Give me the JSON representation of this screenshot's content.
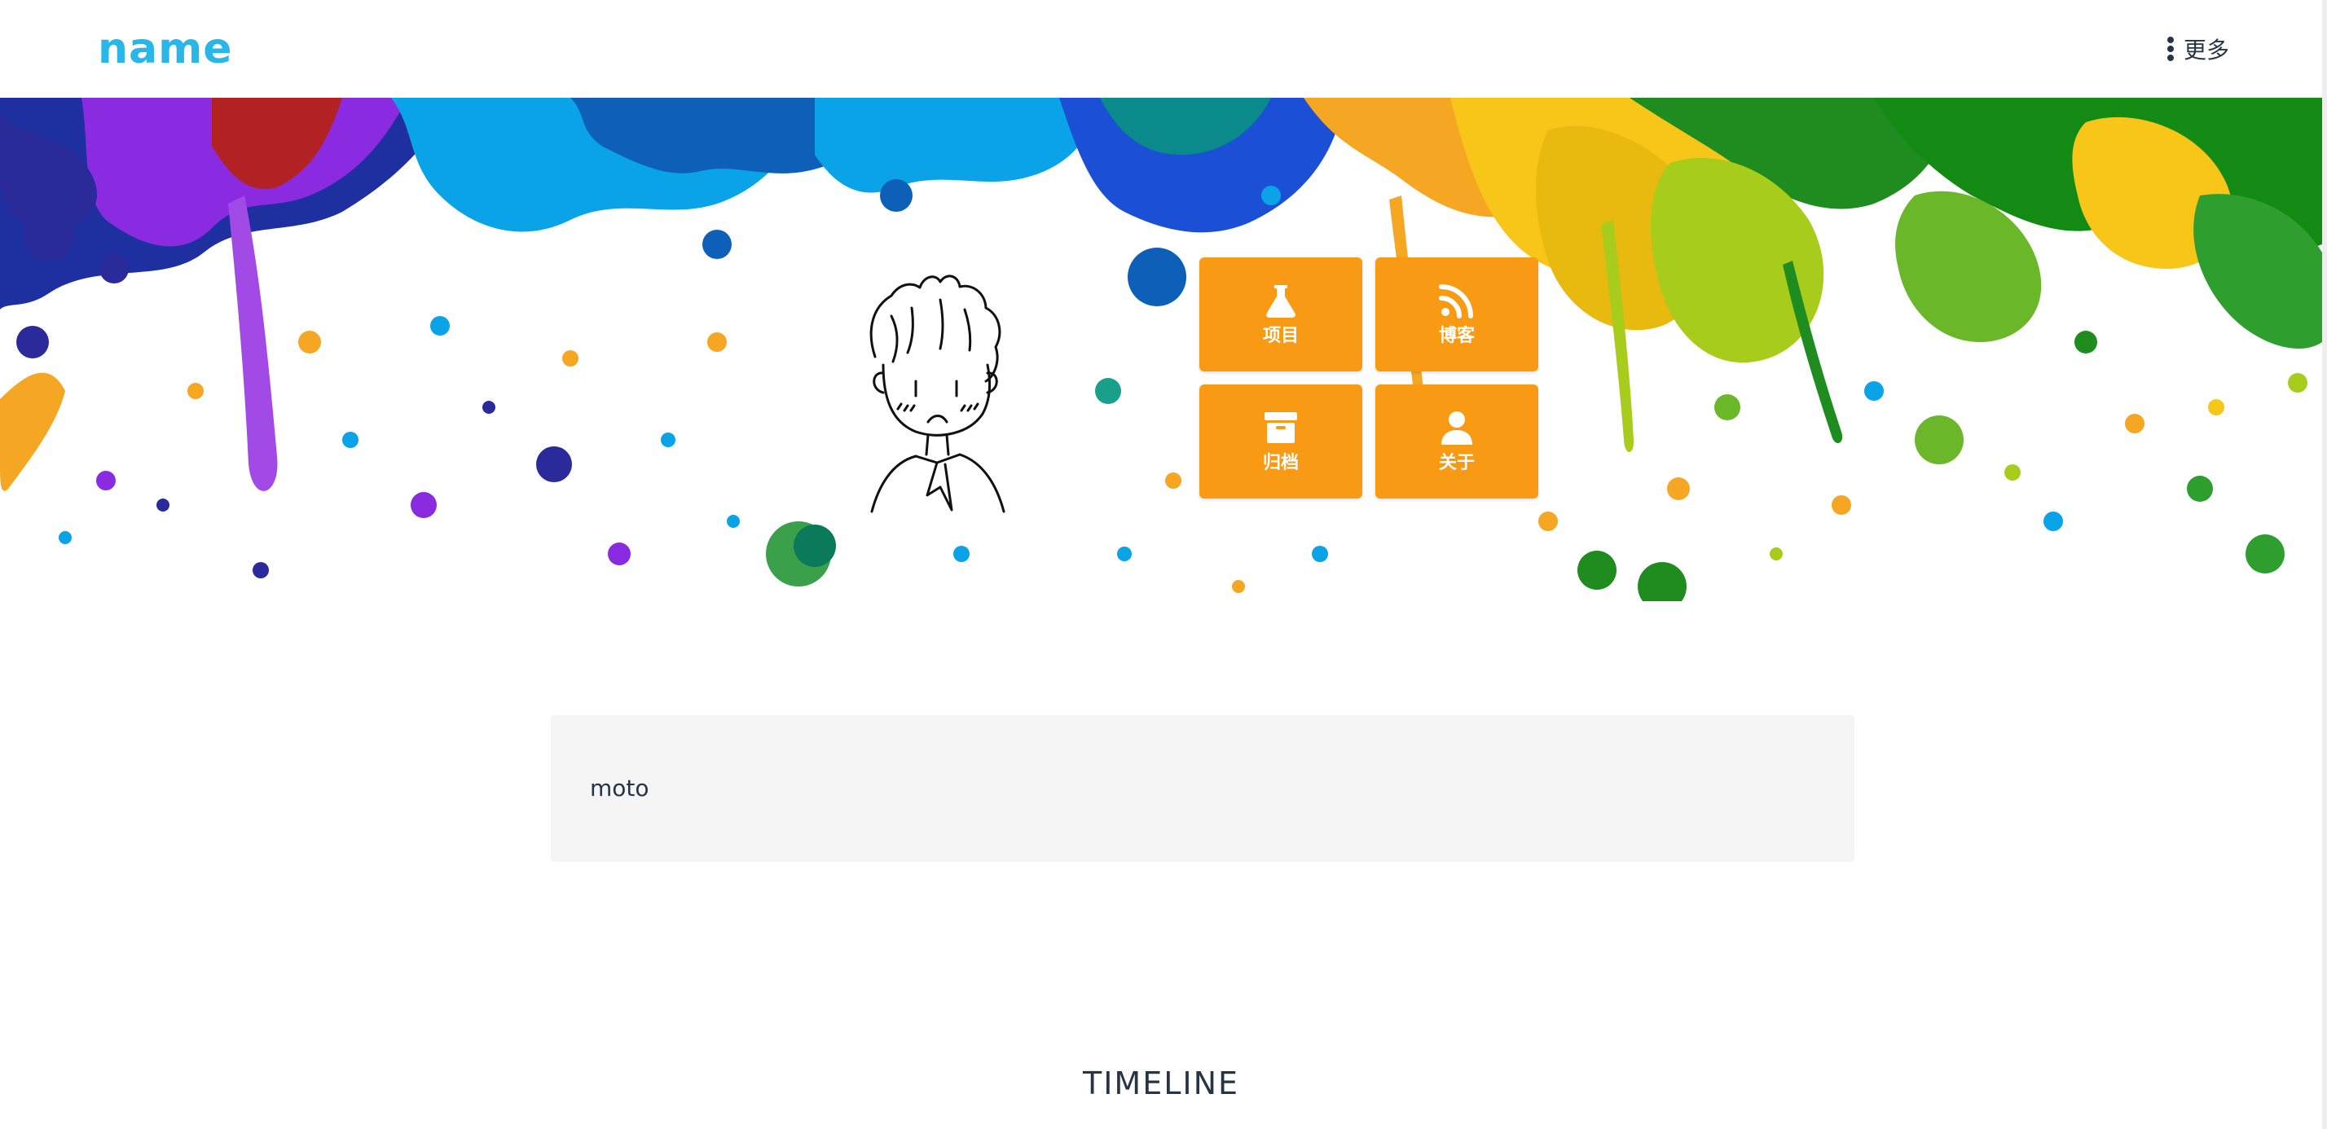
{
  "header": {
    "brand": "name",
    "more_label": "更多",
    "more_icon": "vertical-ellipsis-icon"
  },
  "hero": {
    "tiles": [
      {
        "label": "项目",
        "icon": "flask-icon"
      },
      {
        "label": "博客",
        "icon": "rss-icon"
      },
      {
        "label": "归档",
        "icon": "archive-box-icon"
      },
      {
        "label": "关于",
        "icon": "user-icon"
      }
    ],
    "tile_color": "#f89a14"
  },
  "motto": {
    "text": "moto"
  },
  "timeline": {
    "title": "TIMELINE"
  },
  "colors": {
    "brand": "#29b6e8",
    "text": "#263445",
    "motto_bg": "#f5f5f5"
  }
}
